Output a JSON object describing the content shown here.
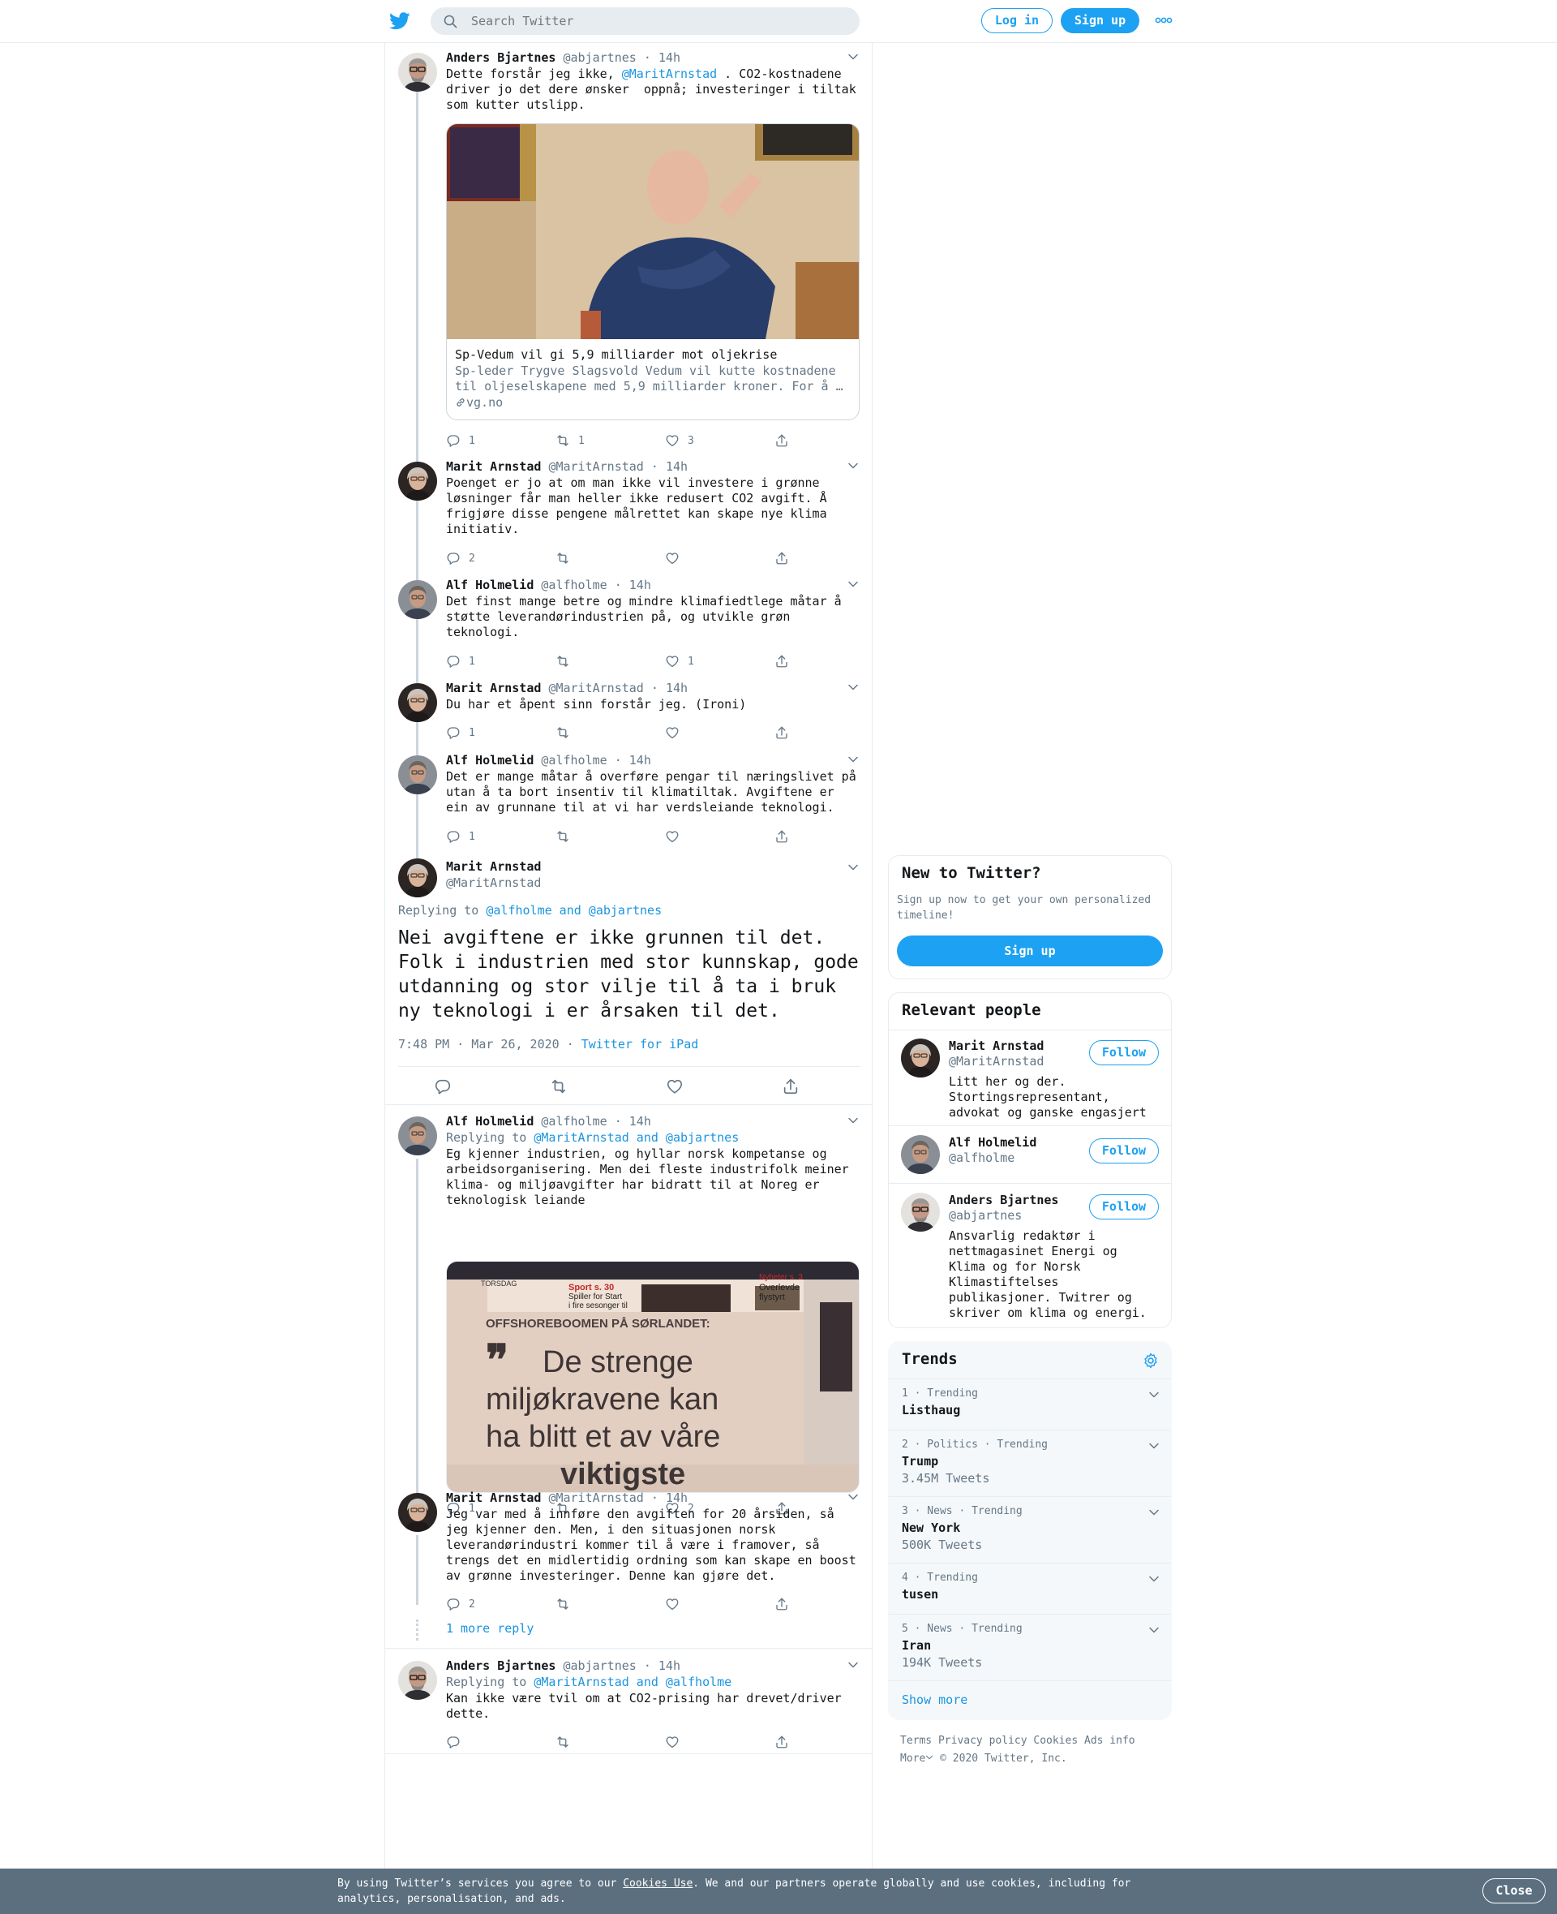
{
  "header": {
    "search_placeholder": "Search Twitter",
    "login_label": "Log in",
    "signup_label": "Sign up"
  },
  "tweets": [
    {
      "name": "Anders Bjartnes",
      "handle": "@abjartnes",
      "time": "14h",
      "text_pre": "Dette forstår jeg ikke, ",
      "mention": "@MaritArnstad",
      "text_post": " . CO2-kostnadene driver jo det dere ønsker  oppnå; investeringer i tiltak som kutter utslipp.",
      "card": {
        "title": "Sp-Vedum vil gi 5,9 milliarder mot oljekrise",
        "description": "Sp-leder Trygve Slagsvold Vedum vil kutte kostnadene til oljeselskapene med 5,9 milliarder kroner. For å …",
        "domain": "vg.no"
      },
      "replies": "1",
      "retweets": "1",
      "likes": "3"
    },
    {
      "name": "Marit Arnstad",
      "handle": "@MaritArnstad",
      "time": "14h",
      "text": "Poenget er jo at om man ikke vil investere i grønne løsninger får man heller ikke redusert CO2 avgift. Å frigjøre disse pengene målrettet kan skape nye klima initiativ.",
      "replies": "2",
      "retweets": "",
      "likes": ""
    },
    {
      "name": "Alf Holmelid",
      "handle": "@alfholme",
      "time": "14h",
      "text": "Det finst mange betre og mindre klimafiedtlege måtar å støtte leverandørindustrien på, og utvikle grøn teknologi.",
      "replies": "1",
      "retweets": "",
      "likes": "1"
    },
    {
      "name": "Marit Arnstad",
      "handle": "@MaritArnstad",
      "time": "14h",
      "text": "Du har et åpent sinn forstår jeg. (Ironi)",
      "replies": "1",
      "retweets": "",
      "likes": ""
    },
    {
      "name": "Alf Holmelid",
      "handle": "@alfholme",
      "time": "14h",
      "text": "Det er mange måtar å overføre pengar til næringslivet på utan å ta bort insentiv til klimatiltak. Avgiftene er ein av grunnane til at vi har verdsleiande teknologi.",
      "replies": "1",
      "retweets": "",
      "likes": ""
    }
  ],
  "focus": {
    "name": "Marit Arnstad",
    "handle": "@MaritArnstad",
    "replying_label": "Replying to ",
    "replying_to": "@alfholme and @abjartnes",
    "text": "Nei avgiftene er ikke grunnen til det. Folk i industrien med stor kunnskap, gode utdanning og stor vilje til å ta i bruk ny teknologi i er årsaken til det.",
    "time": "7:48 PM · Mar 26, 2020",
    "dot": " · ",
    "source": "Twitter for iPad"
  },
  "replies_below": [
    {
      "name": "Alf Holmelid",
      "handle": "@alfholme",
      "time": "14h",
      "replying_label": "Replying to ",
      "replying_to": "@MaritArnstad and @abjartnes",
      "text": "Eg kjenner industrien, og hyllar norsk kompetanse og arbeidsorganisering. Men dei fleste industrifolk meiner klima- og miljøavgifter har bidratt til at Noreg er teknologisk leiande",
      "image_caption": {
        "header": "OFFSHOREBOOMEN PÅ SØRLANDET:",
        "line1": "De strenge",
        "line2": "miljøkravene kan",
        "line3": "ha blitt et av våre",
        "line4": "viktigste",
        "sport": "Sport s. 30",
        "sport2": "Spiller for Start",
        "sport3": "i fire sesonger til",
        "nyheter": "Nyheter s. 3",
        "nyheter2": "Overlevde",
        "nyheter3": "flystyrt"
      },
      "replies": "1",
      "retweets": "",
      "likes": "2"
    },
    {
      "name": "Marit Arnstad",
      "handle": "@MaritArnstad",
      "time": "14h",
      "text": "Jeg var med å innføre den avgiften for 20 årsiden, så jeg kjenner den. Men, i den situasjonen norsk leverandørindustri kommer til å være i framover, så trengs det en midlertidig ordning som kan skape en boost av grønne investeringer. Denne kan gjøre det.",
      "replies": "2",
      "retweets": "",
      "likes": ""
    },
    {
      "more_reply": "1 more reply"
    },
    {
      "name": "Anders Bjartnes",
      "handle": "@abjartnes",
      "time": "14h",
      "replying_label": "Replying to ",
      "replying_to": "@MaritArnstad and @alfholme",
      "text": "Kan ikke være tvil om at CO2-prising har drevet/driver dette.",
      "replies": "",
      "retweets": "",
      "likes": ""
    }
  ],
  "sidebar": {
    "new_title": "New to Twitter?",
    "new_text": "Sign up now to get your own personalized timeline!",
    "new_signup": "Sign up",
    "relevant_title": "Relevant people",
    "people": [
      {
        "name": "Marit Arnstad",
        "handle": "@MaritArnstad",
        "bio": "Litt her og der. Stortingsrepresentant, advokat og ganske engasjert",
        "follow": "Follow"
      },
      {
        "name": "Alf Holmelid",
        "handle": "@alfholme",
        "bio": "",
        "follow": "Follow"
      },
      {
        "name": "Anders Bjartnes",
        "handle": "@abjartnes",
        "bio": "Ansvarlig redaktør i nettmagasinet Energi og Klima og for Norsk Klimastiftelses publikasjoner. Twitrer og skriver om klima og energi.",
        "follow": "Follow"
      }
    ],
    "trends_title": "Trends",
    "trends": [
      {
        "meta": "1 · Trending",
        "name": "Listhaug",
        "count": ""
      },
      {
        "meta": "2 · Politics · Trending",
        "name": "Trump",
        "count": "3.45M Tweets"
      },
      {
        "meta": "3 · News · Trending",
        "name": "New York",
        "count": "500K Tweets"
      },
      {
        "meta": "4 · Trending",
        "name": "tusen",
        "count": ""
      },
      {
        "meta": "5 · News · Trending",
        "name": "Iran",
        "count": "194K Tweets"
      }
    ],
    "show_more": "Show more",
    "footer": {
      "terms": "Terms",
      "privacy": "Privacy policy",
      "cookies": "Cookies",
      "ads": "Ads info",
      "more": "More",
      "copyright": "© 2020 Twitter, Inc."
    }
  },
  "cookie": {
    "text_pre": "By using Twitter’s services you agree to our ",
    "link": "Cookies Use",
    "text_post": ". We and our partners operate globally and use cookies, including for analytics, personalisation, and ads.",
    "close": "Close"
  },
  "colors": {
    "accent": "#1da1f2",
    "link": "#1b95e0",
    "secondary": "#657786",
    "border": "#e6ecf0",
    "cookie_bg": "#5c6f7f"
  }
}
